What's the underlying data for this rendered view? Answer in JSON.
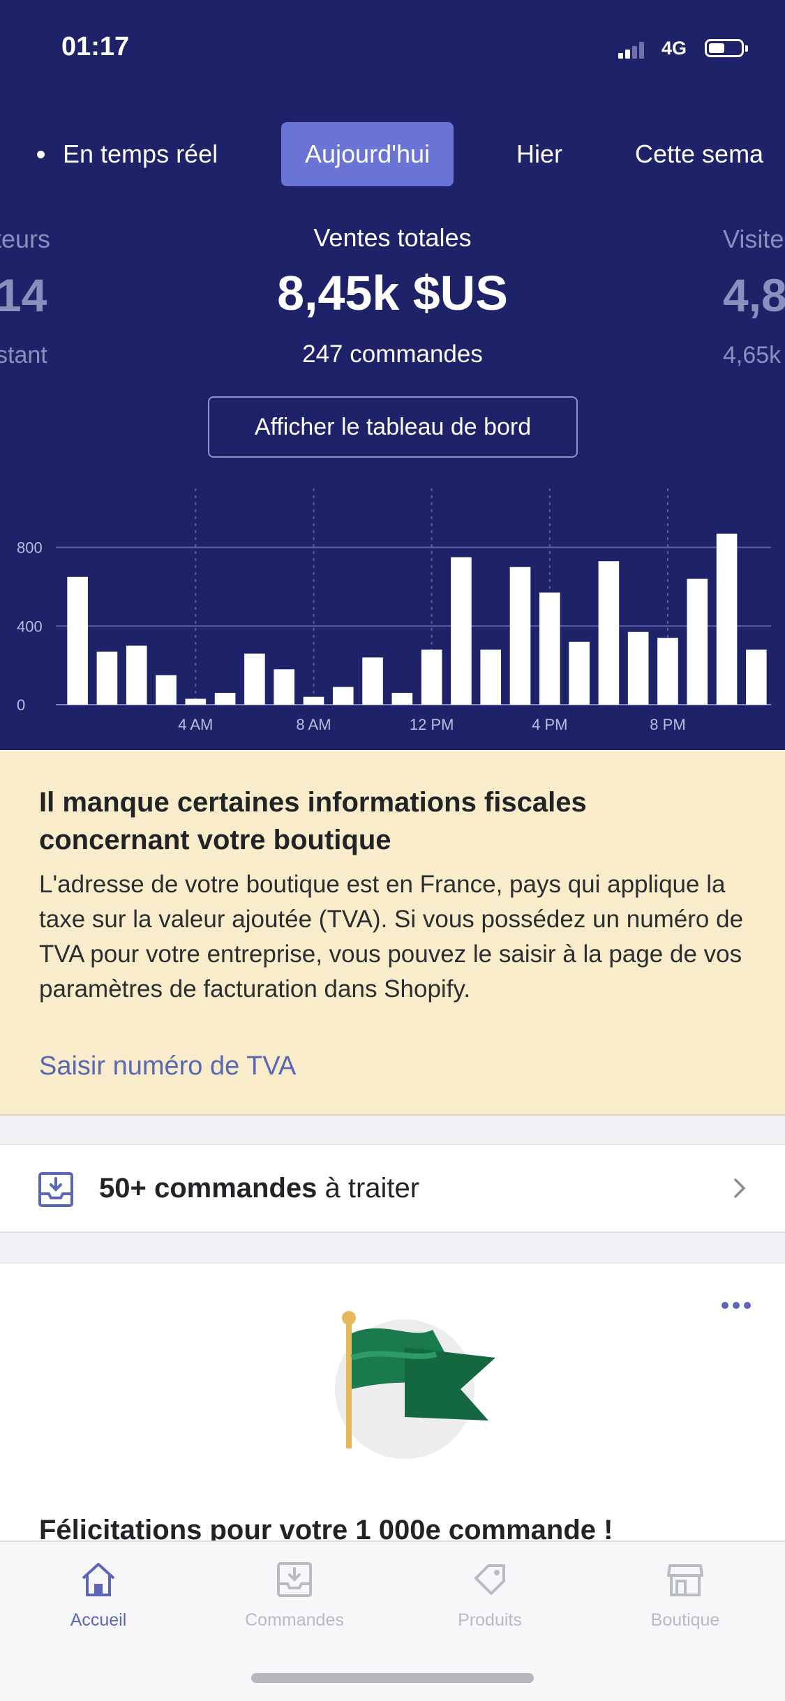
{
  "status_bar": {
    "time": "01:17",
    "network": "4G"
  },
  "period_tabs": [
    {
      "label": "En temps réel",
      "active": false
    },
    {
      "label": "Aujourd'hui",
      "active": true
    },
    {
      "label": "Hier",
      "active": false
    },
    {
      "label": "Cette sema",
      "active": false
    }
  ],
  "metrics": {
    "left_partial": {
      "label": "teurs",
      "value": "14",
      "sub": "stant"
    },
    "center": {
      "label": "Ventes totales",
      "value": "8,45k $US",
      "sub": "247 commandes"
    },
    "right_partial": {
      "label": "Visite",
      "value": "4,8",
      "sub": "4,65k"
    }
  },
  "dashboard_button": "Afficher le tableau de bord",
  "chart_data": {
    "type": "bar",
    "title": "",
    "xlabel": "",
    "ylabel": "",
    "ylim": [
      0,
      1100
    ],
    "yticks": [
      0,
      400,
      800
    ],
    "xtick_labels": [
      {
        "hour": 4,
        "label": "4 AM"
      },
      {
        "hour": 8,
        "label": "8 AM"
      },
      {
        "hour": 12,
        "label": "12 PM"
      },
      {
        "hour": 16,
        "label": "4 PM"
      },
      {
        "hour": 20,
        "label": "8 PM"
      }
    ],
    "grid": true,
    "categories": [
      "0",
      "1",
      "2",
      "3",
      "4",
      "5",
      "6",
      "7",
      "8",
      "9",
      "10",
      "11",
      "12",
      "13",
      "14",
      "15",
      "16",
      "17",
      "18",
      "19",
      "20",
      "21",
      "22",
      "23",
      "24"
    ],
    "values": [
      650,
      270,
      300,
      150,
      30,
      60,
      260,
      180,
      40,
      90,
      240,
      60,
      280,
      750,
      280,
      700,
      570,
      320,
      730,
      370,
      340,
      640,
      870,
      280
    ],
    "bar_color": "#ffffff",
    "grid_color": "#5a5fa6"
  },
  "tax_notice": {
    "title": "Il manque certaines informations fiscales concernant votre boutique",
    "body": "L'adresse de votre boutique est en France, pays qui applique la taxe sur la valeur ajoutée (TVA). Si vous possédez un numéro de TVA pour votre entreprise, vous pouvez le saisir à la page de vos paramètres de facturation dans Shopify.",
    "link": "Saisir numéro de TVA"
  },
  "orders_row": {
    "count": "50+ commandes",
    "suffix": " à traiter"
  },
  "milestone_card": {
    "title": "Félicitations pour votre 1 000e commande !"
  },
  "bottom_tabs": [
    {
      "label": "Accueil",
      "icon": "home-icon",
      "active": true
    },
    {
      "label": "Commandes",
      "icon": "orders-icon",
      "active": false
    },
    {
      "label": "Produits",
      "icon": "tag-icon",
      "active": false
    },
    {
      "label": "Boutique",
      "icon": "store-icon",
      "active": false
    }
  ],
  "colors": {
    "header_bg": "#1e2268",
    "active_tab": "#6974d6",
    "notice_bg": "#f8ecca",
    "link": "#5a67b5",
    "flag_green": "#1a7a4c"
  }
}
